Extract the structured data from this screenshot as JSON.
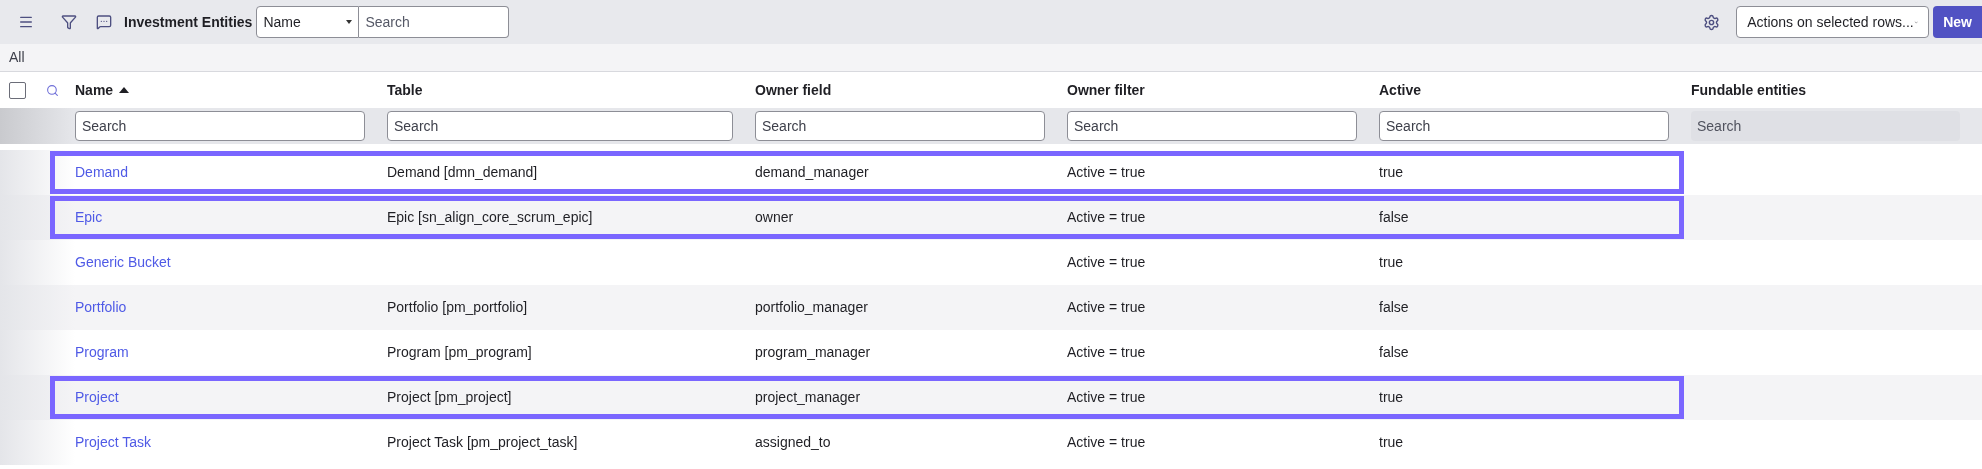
{
  "toolbar": {
    "title": "Investment Entities",
    "field_select": "Name",
    "search": {
      "placeholder": "Search"
    },
    "actions_select": "Actions on selected rows...",
    "new_button": "New"
  },
  "breadcrumb": "All",
  "select_all": {
    "checked": false
  },
  "columns": [
    {
      "label": "Name",
      "sorted": true,
      "search": {
        "placeholder": "Search",
        "disabled": false
      }
    },
    {
      "label": "Table",
      "sorted": false,
      "search": {
        "placeholder": "Search",
        "disabled": false
      }
    },
    {
      "label": "Owner field",
      "sorted": false,
      "search": {
        "placeholder": "Search",
        "disabled": false
      }
    },
    {
      "label": "Owner filter",
      "sorted": false,
      "search": {
        "placeholder": "Search",
        "disabled": false
      }
    },
    {
      "label": "Active",
      "sorted": false,
      "search": {
        "placeholder": "Search",
        "disabled": false
      }
    },
    {
      "label": "Fundable entities",
      "sorted": false,
      "search": {
        "placeholder": "Search",
        "disabled": true
      }
    }
  ],
  "rows": [
    {
      "name": "Demand",
      "table": "Demand [dmn_demand]",
      "owner_field": "demand_manager",
      "owner_filter": "Active = true",
      "active": "true",
      "highlighted": true
    },
    {
      "name": "Epic",
      "table": "Epic [sn_align_core_scrum_epic]",
      "owner_field": "owner",
      "owner_filter": "Active = true",
      "active": "false",
      "highlighted": true
    },
    {
      "name": "Generic Bucket",
      "owner_filter": "Active = true",
      "active": "true",
      "highlighted": false
    },
    {
      "name": "Portfolio",
      "table": "Portfolio [pm_portfolio]",
      "owner_field": "portfolio_manager",
      "owner_filter": "Active = true",
      "active": "false",
      "highlighted": false
    },
    {
      "name": "Program",
      "table": "Program [pm_program]",
      "owner_field": "program_manager",
      "owner_filter": "Active = true",
      "active": "false",
      "highlighted": false
    },
    {
      "name": "Project",
      "table": "Project [pm_project]",
      "owner_field": "project_manager",
      "owner_filter": "Active = true",
      "active": "true",
      "highlighted": true
    },
    {
      "name": "Project Task",
      "table": "Project Task [pm_project_task]",
      "owner_field": "assigned_to",
      "owner_filter": "Active = true",
      "active": "true",
      "highlighted": false
    }
  ]
}
